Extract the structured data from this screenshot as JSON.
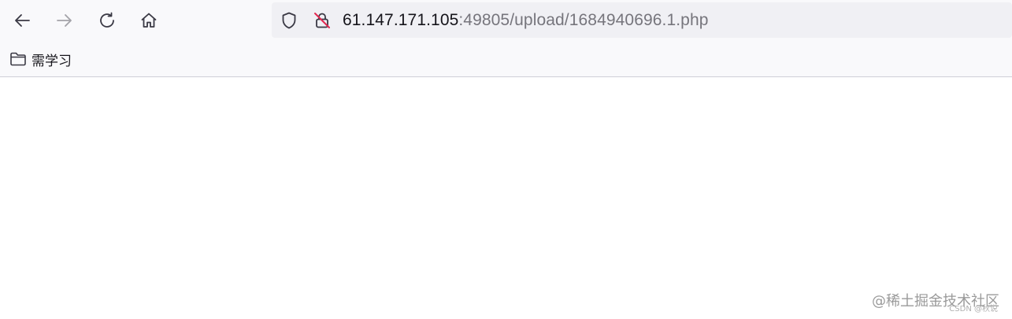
{
  "navigation": {
    "back_icon": "arrow-left-icon",
    "forward_icon": "arrow-right-icon",
    "reload_icon": "reload-icon",
    "home_icon": "home-icon"
  },
  "urlbar": {
    "shield_icon": "shield-icon",
    "insecure_lock_icon": "insecure-lock-icon",
    "host": "61.147.171.105",
    "path": ":49805/upload/1684940696.1.php"
  },
  "bookmarks": {
    "items": [
      {
        "label": "需学习",
        "icon": "folder-icon"
      }
    ]
  },
  "watermark": {
    "main": "@稀土掘金技术社区",
    "sub": "CSDN @秋说"
  },
  "colors": {
    "chrome_bg": "#f9f9fb",
    "urlbar_bg": "#f0f0f4",
    "host_text": "#15141a",
    "path_text": "#76757c",
    "insecure_accent": "#e22850"
  }
}
